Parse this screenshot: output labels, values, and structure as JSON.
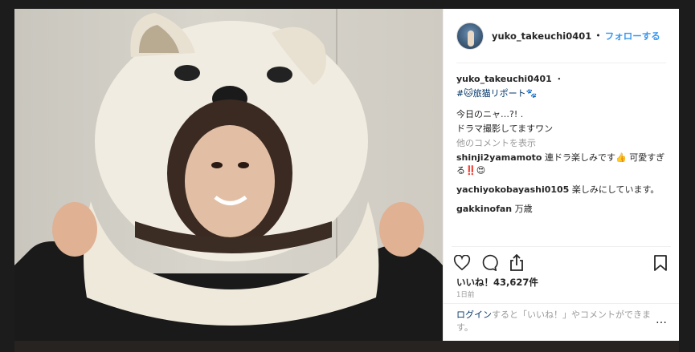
{
  "post": {
    "username": "yuko_takeuchi0401",
    "follow_label": "フォロー",
    "follow_suffix": "する",
    "caption_dot": "・",
    "tag_line": "#🐱旅猫リポート🐾",
    "caption_line1": "今日のニャ…?! .",
    "caption_line2": "ドラマ撮影してますワン",
    "more_comments": "他のコメントを表示",
    "comments": [
      {
        "user": "shinji2yamamoto",
        "text": "連ドラ楽しみです👍 可愛すぎる‼️😍"
      },
      {
        "user": "yachiyokobayashi0105",
        "text": "楽しみにしています。"
      },
      {
        "user": "gakkinofan",
        "text": "万歳"
      }
    ],
    "likes": "いいね！43,627件",
    "timestamp": "1日前",
    "login_link": "ログイン",
    "login_text": "すると「いいね！」やコメントができます。",
    "more_icon": "…"
  },
  "icons": [
    "heart-icon",
    "comment-icon",
    "share-icon",
    "bookmark-icon"
  ],
  "colors": {
    "link": "#3897f0",
    "text": "#262626",
    "muted": "#999999"
  }
}
